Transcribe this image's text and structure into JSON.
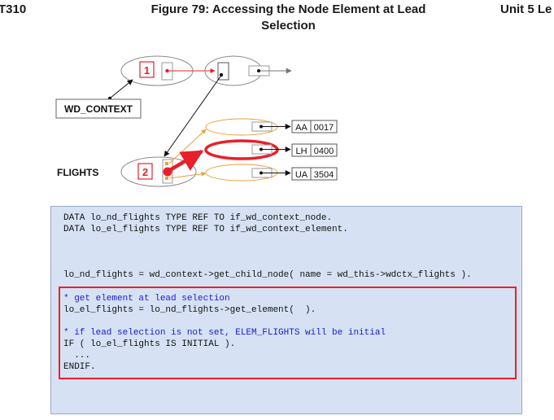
{
  "header": {
    "left": "T310",
    "title_line1": "Figure 79: Accessing the Node Element at Lead",
    "title_line2": "Selection",
    "right": "Unit 5 Le"
  },
  "diagram": {
    "context_label": "WD_CONTEXT",
    "flights_label": "FLIGHTS",
    "node_1": "1",
    "node_2": "2",
    "elements": [
      {
        "carrier": "AA",
        "connid": "0017"
      },
      {
        "carrier": "LH",
        "connid": "0400"
      },
      {
        "carrier": "UA",
        "connid": "3504"
      }
    ],
    "colors": {
      "red": "#e8202a",
      "orange": "#e8a23a",
      "gray": "#8a8a8a"
    }
  },
  "code": {
    "lines_declare": [
      "DATA lo_nd_flights TYPE REF TO if_wd_context_node.",
      "DATA lo_el_flights TYPE REF TO if_wd_context_element."
    ],
    "line_child": "lo_nd_flights = wd_context->get_child_node( name = wd_this->wdctx_flights ).",
    "comment_1": "* get element at lead selection",
    "line_get": "lo_el_flights = lo_nd_flights->get_element(  ).",
    "comment_2": "* if lead selection is not set, ELEM_FLIGHTS will be initial",
    "line_if": "IF ( lo_el_flights IS INITIAL ).",
    "line_dots": "  ...",
    "line_endif": "ENDIF."
  }
}
